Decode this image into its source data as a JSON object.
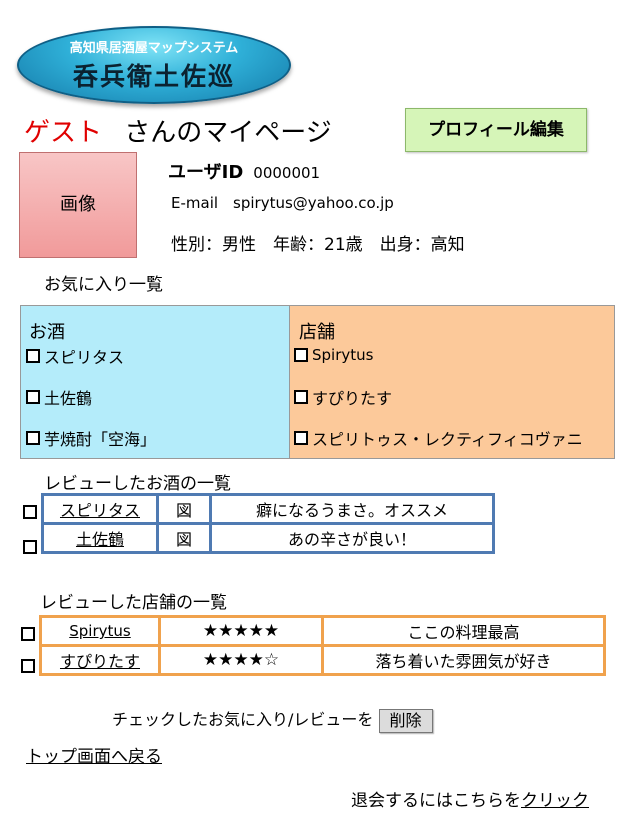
{
  "logo": {
    "subtitle": "高知県居酒屋マップシステム",
    "name": "呑兵衛土佐巡"
  },
  "header": {
    "user_name": "ゲスト",
    "title_suffix": "さんのマイページ",
    "edit_profile_label": "プロフィール編集"
  },
  "profile": {
    "avatar_label": "画像",
    "user_id_label": "ユーザID",
    "user_id_value": "0000001",
    "email_line": "E-mail　spirytus@yahoo.co.jp",
    "details_line": "性別：男性　年齢：21歳　出身：高知"
  },
  "favorites": {
    "heading": "お気に入り一覧",
    "sake_heading": "お酒",
    "sake_items": [
      "スピリタス",
      "土佐鶴",
      "芋焼酎「空海」"
    ],
    "store_heading": "店舗",
    "store_items": [
      "Spirytus",
      "すぴりたす",
      "スピリトゥス・レクティフィコヴァニ"
    ]
  },
  "sake_reviews": {
    "heading": "レビューしたお酒の一覧",
    "rows": [
      {
        "name": "スピリタス",
        "figure": "図",
        "comment": "癖になるうまさ。オススメ"
      },
      {
        "name": "土佐鶴",
        "figure": "図",
        "comment": "あの辛さが良い！"
      }
    ]
  },
  "store_reviews": {
    "heading": "レビューした店舗の一覧",
    "rows": [
      {
        "name": "Spirytus",
        "rating": "★★★★★",
        "comment": "ここの料理最高"
      },
      {
        "name": "すぴりたす",
        "rating": "★★★★☆",
        "comment": "落ち着いた雰囲気が好き"
      }
    ]
  },
  "actions": {
    "delete_prompt": "チェックしたお気に入り/レビューを",
    "delete_label": "削除",
    "back_link": "トップ画面へ戻る",
    "withdraw_text": "退会するにはこちらを",
    "withdraw_link": "クリック"
  }
}
